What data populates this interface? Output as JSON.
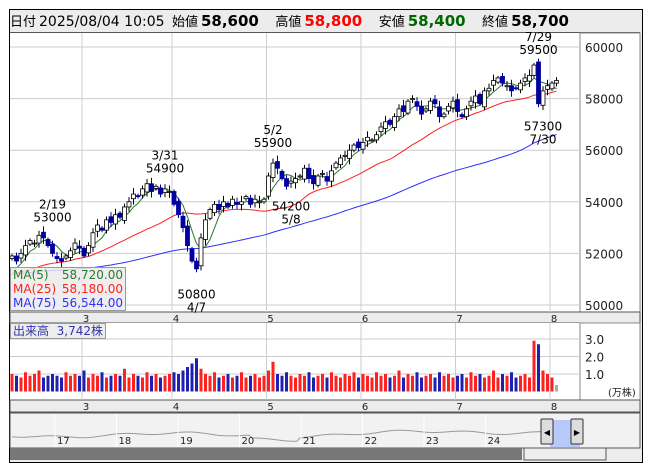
{
  "header": {
    "date_label": "日付",
    "datetime": "2025/08/04 10:05",
    "open_label": "始値",
    "open": "58,600",
    "high_label": "高値",
    "high": "58,800",
    "low_label": "安値",
    "low": "58,400",
    "close_label": "終値",
    "close": "58,700"
  },
  "ma_legend": [
    {
      "name": "MA(5)",
      "value": "58,720.00",
      "color": "#2a7a2a"
    },
    {
      "name": "MA(25)",
      "value": "58,180.00",
      "color": "#ff2020"
    },
    {
      "name": "MA(75)",
      "value": "56,544.00",
      "color": "#3030ff"
    }
  ],
  "volume_legend": {
    "label": "出来高",
    "value": "3,742株"
  },
  "volume_unit": "(万株)",
  "navigator": {
    "year_labels": [
      "17",
      "18",
      "19",
      "20",
      "21",
      "22",
      "23",
      "24"
    ]
  },
  "chart_data": {
    "type": "candlestick",
    "price_axis": {
      "ylim": [
        50000,
        60000
      ],
      "ticks": [
        "50000",
        "52000",
        "54000",
        "56000",
        "58000",
        "60000"
      ]
    },
    "volume_axis": {
      "ylim": [
        0,
        3.3
      ],
      "ticks": [
        "1.0",
        "2.0",
        "3.0"
      ],
      "unit": "万株"
    },
    "month_labels": [
      {
        "label": "3",
        "index": 16
      },
      {
        "label": "4",
        "index": 36
      },
      {
        "label": "5",
        "index": 57
      },
      {
        "label": "6",
        "index": 78
      },
      {
        "label": "7",
        "index": 99
      },
      {
        "label": "8",
        "index": 120
      }
    ],
    "closes": [
      51900,
      51700,
      52000,
      52300,
      52500,
      52400,
      52700,
      52600,
      52300,
      52000,
      51800,
      51700,
      51900,
      52100,
      52400,
      52200,
      51900,
      52300,
      52800,
      53100,
      52900,
      53300,
      53200,
      53500,
      53400,
      53800,
      54000,
      54300,
      54200,
      54500,
      54700,
      54400,
      54600,
      54300,
      54500,
      54400,
      53900,
      53500,
      53000,
      52300,
      51700,
      51400,
      52600,
      53300,
      53700,
      53900,
      53700,
      54000,
      53800,
      54100,
      53900,
      54000,
      54200,
      53900,
      54100,
      54000,
      54100,
      55000,
      55500,
      55300,
      54900,
      54600,
      54800,
      54900,
      55000,
      55300,
      54900,
      54700,
      55000,
      55100,
      54800,
      55200,
      55500,
      55700,
      55800,
      56000,
      56200,
      56100,
      56300,
      56500,
      56400,
      56600,
      56900,
      57100,
      57000,
      57300,
      57600,
      57500,
      57900,
      58000,
      57700,
      57400,
      57600,
      57900,
      57800,
      57300,
      57400,
      57700,
      57900,
      57500,
      57300,
      57600,
      57900,
      58100,
      57800,
      58300,
      58400,
      58700,
      58800,
      58600,
      58500,
      58300,
      58400,
      58600,
      58800,
      58900,
      59300,
      57800,
      58300,
      58500,
      58600,
      58700
    ],
    "volumes": [
      1.0,
      0.9,
      0.8,
      1.1,
      0.9,
      1.0,
      1.2,
      0.8,
      0.9,
      1.0,
      0.9,
      0.8,
      1.1,
      0.9,
      1.0,
      0.9,
      1.2,
      0.8,
      1.0,
      0.9,
      1.1,
      0.8,
      0.9,
      1.0,
      0.9,
      1.3,
      0.8,
      1.0,
      0.9,
      0.8,
      1.1,
      0.9,
      1.0,
      0.8,
      0.9,
      1.0,
      1.1,
      1.0,
      1.2,
      1.4,
      1.6,
      1.9,
      1.3,
      1.0,
      0.9,
      1.1,
      0.8,
      0.9,
      1.0,
      0.8,
      0.9,
      1.1,
      0.8,
      0.9,
      1.0,
      0.8,
      0.9,
      1.2,
      1.7,
      1.0,
      0.9,
      1.1,
      0.9,
      0.8,
      1.0,
      0.9,
      1.1,
      0.8,
      0.9,
      1.0,
      0.8,
      1.1,
      0.9,
      0.8,
      1.0,
      0.9,
      1.1,
      0.8,
      1.0,
      0.9,
      0.8,
      1.1,
      0.9,
      1.0,
      0.8,
      0.9,
      1.2,
      0.8,
      1.0,
      0.9,
      1.1,
      0.8,
      0.9,
      1.0,
      0.8,
      1.1,
      0.9,
      1.0,
      0.8,
      0.9,
      1.0,
      0.8,
      1.1,
      0.9,
      1.0,
      0.8,
      0.9,
      1.2,
      0.8,
      1.0,
      0.9,
      1.1,
      0.8,
      0.9,
      1.0,
      0.8,
      2.9,
      2.7,
      1.2,
      1.0,
      0.8,
      0.37
    ],
    "annotations": [
      {
        "date": "2/19",
        "price": "53000",
        "index": 9,
        "pos": "above"
      },
      {
        "date": "3/31",
        "price": "54900",
        "index": 34,
        "pos": "above"
      },
      {
        "date": "4/7",
        "price": "50800",
        "index": 41,
        "pos": "below"
      },
      {
        "date": "5/2",
        "price": "55900",
        "index": 58,
        "pos": "above"
      },
      {
        "date": "5/8",
        "price": "54200",
        "index": 62,
        "pos": "below"
      },
      {
        "date": "7/29",
        "price": "59500",
        "index": 117,
        "pos": "above"
      },
      {
        "date": "7/30",
        "price": "57300",
        "index": 118,
        "pos": "below"
      }
    ]
  }
}
